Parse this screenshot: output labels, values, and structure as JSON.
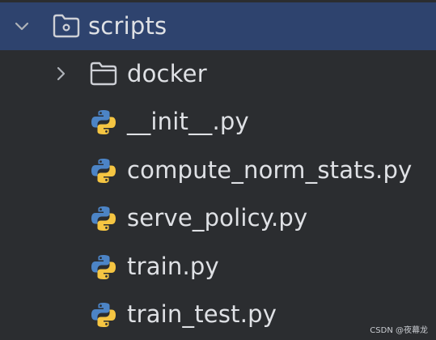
{
  "tree": {
    "root": {
      "label": "scripts",
      "expanded": true,
      "selected": true,
      "icon": "folder-source-icon"
    },
    "folders": [
      {
        "label": "docker",
        "expanded": false,
        "icon": "folder-icon"
      }
    ],
    "files": [
      {
        "label": "__init__.py",
        "icon": "python-file-icon"
      },
      {
        "label": "compute_norm_stats.py",
        "icon": "python-file-icon"
      },
      {
        "label": "serve_policy.py",
        "icon": "python-file-icon"
      },
      {
        "label": "train.py",
        "icon": "python-file-icon"
      },
      {
        "label": "train_test.py",
        "icon": "python-file-icon"
      }
    ]
  },
  "colors": {
    "background": "#2b2d30",
    "selection": "#2e436e",
    "text": "#dfe1e5",
    "python_blue": "#4c84c6",
    "python_yellow": "#f5c542"
  },
  "watermark": "CSDN @夜幕龙"
}
